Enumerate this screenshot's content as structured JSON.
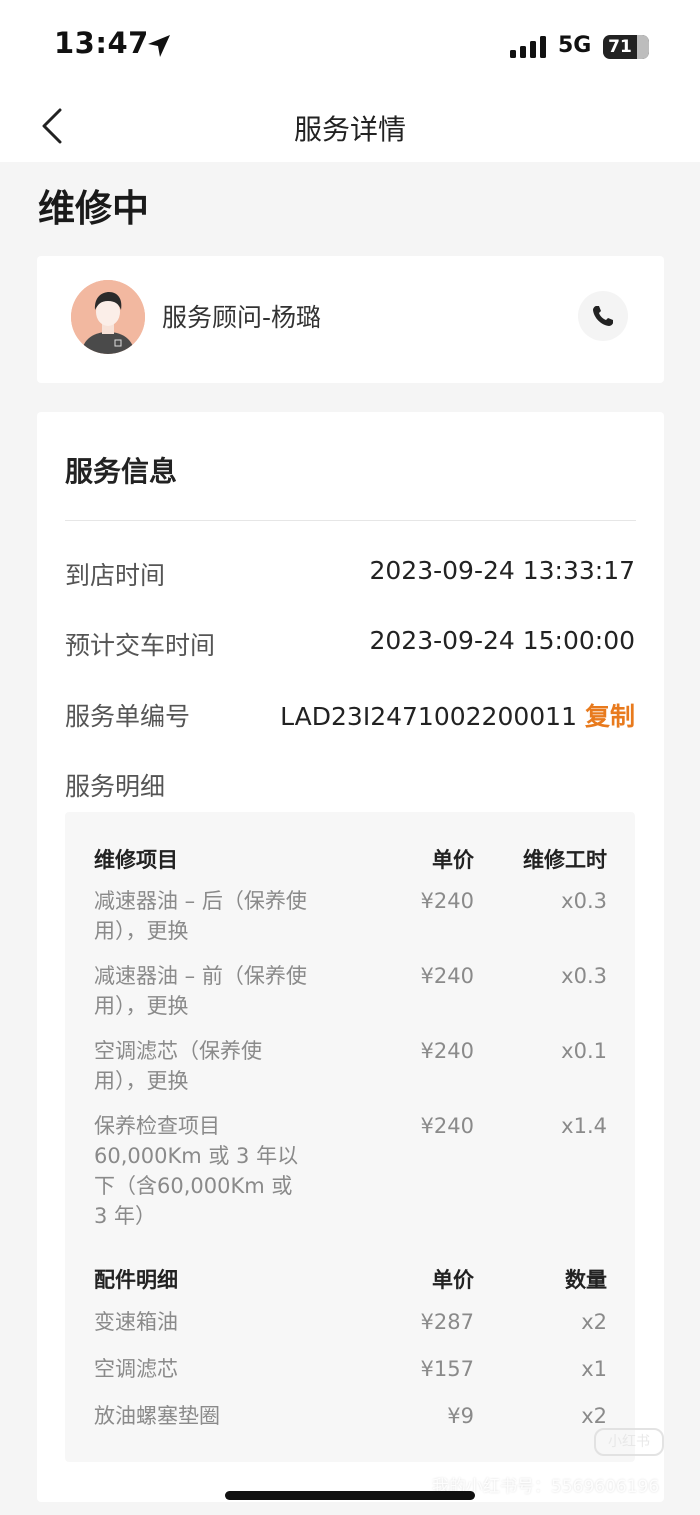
{
  "status_bar": {
    "time": "13:47",
    "network": "5G",
    "battery": "71",
    "icons": [
      "location-arrow-icon",
      "signal-bars-icon",
      "battery-icon"
    ]
  },
  "nav": {
    "title": "服务详情",
    "back_icon": "chevron-left-icon"
  },
  "order_status": "维修中",
  "advisor": {
    "name": "服务顾问-杨璐",
    "phone_icon": "phone-icon"
  },
  "service_info": {
    "title": "服务信息",
    "arrival_label": "到店时间",
    "arrival_value": "2023-09-24 13:33:17",
    "delivery_label": "预计交车时间",
    "delivery_value": "2023-09-24 15:00:00",
    "order_no_label": "服务单编号",
    "order_no_value": "LAD23I2471002200011",
    "copy_label": "复制",
    "detail_label": "服务明细"
  },
  "repair_items": {
    "headers": [
      "维修项目",
      "单价",
      "维修工时"
    ],
    "rows": [
      {
        "name": "减速器油 – 后（保养使用），更换",
        "price": "¥240",
        "qty": "x0.3"
      },
      {
        "name": "减速器油 – 前（保养使用），更换",
        "price": "¥240",
        "qty": "x0.3"
      },
      {
        "name": "空调滤芯（保养使用），更换",
        "price": "¥240",
        "qty": "x0.1"
      },
      {
        "name": "保养检查项目 60,000Km 或 3 年以下（含60,000Km 或 3 年）",
        "price": "¥240",
        "qty": "x1.4"
      }
    ]
  },
  "parts": {
    "headers": [
      "配件明细",
      "单价",
      "数量"
    ],
    "rows": [
      {
        "name": "变速箱油",
        "price": "¥287",
        "qty": "x2"
      },
      {
        "name": "空调滤芯",
        "price": "¥157",
        "qty": "x1"
      },
      {
        "name": "放油螺塞垫圈",
        "price": "¥9",
        "qty": "x2"
      }
    ]
  },
  "watermark": {
    "logo": "小红书",
    "text": "我的小红书号：5569606196"
  },
  "colors": {
    "accent": "#e87a1d",
    "background": "#f5f5f5",
    "card": "#ffffff"
  }
}
